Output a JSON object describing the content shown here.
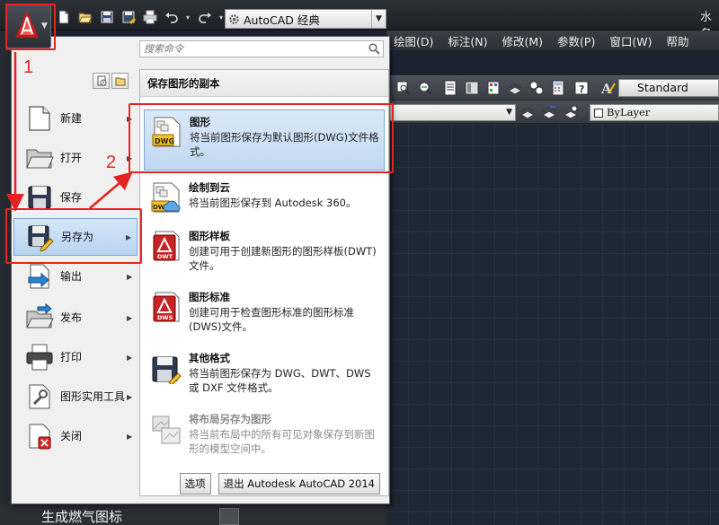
{
  "qat": {
    "workspace": "AutoCAD 经典"
  },
  "window": {
    "title_fragment": "水务"
  },
  "menubar": [
    "绘图(D)",
    "标注(N)",
    "修改(M)",
    "参数(P)",
    "窗口(W)",
    "帮助"
  ],
  "toolbar": {
    "text_style": "Standard",
    "color_control": "ByLayer"
  },
  "app_menu": {
    "search_placeholder": "搜索命令",
    "left_items": [
      {
        "label": "新建",
        "icon": "new-file-icon",
        "submenu": true
      },
      {
        "label": "打开",
        "icon": "open-folder-icon",
        "submenu": true
      },
      {
        "label": "保存",
        "icon": "save-disk-icon",
        "submenu": false
      },
      {
        "label": "另存为",
        "icon": "save-as-icon",
        "submenu": true
      },
      {
        "label": "输出",
        "icon": "export-icon",
        "submenu": true
      },
      {
        "label": "发布",
        "icon": "publish-icon",
        "submenu": true
      },
      {
        "label": "打印",
        "icon": "printer-icon",
        "submenu": true
      },
      {
        "label": "图形实用工具",
        "icon": "drawing-utilities-icon",
        "submenu": true
      },
      {
        "label": "关闭",
        "icon": "close-file-icon",
        "submenu": true
      }
    ],
    "submenu": {
      "header": "保存图形的副本",
      "items": [
        {
          "title": "图形",
          "desc": "将当前图形保存为默认图形(DWG)文件格式。",
          "icon": "dwg-file-icon",
          "badge": "DWG"
        },
        {
          "title": "绘制到云",
          "desc": "将当前图形保存到 Autodesk 360。",
          "icon": "dwg-cloud-icon",
          "badge": "DWG"
        },
        {
          "title": "图形样板",
          "desc": "创建可用于创建新图形的图形样板(DWT)文件。",
          "icon": "dwt-template-icon",
          "badge": "DWT"
        },
        {
          "title": "图形标准",
          "desc": "创建可用于检查图形标准的图形标准(DWS)文件。",
          "icon": "dws-standards-icon",
          "badge": "DWS"
        },
        {
          "title": "其他格式",
          "desc": "将当前图形保存为 DWG、DWT、DWS 或 DXF 文件格式。",
          "icon": "save-other-formats-icon",
          "badge": ""
        },
        {
          "title": "将布局另存为图形",
          "desc": "将当前布局中的所有可见对象保存到新图形的模型空间中。",
          "icon": "save-layout-icon",
          "badge": ""
        }
      ]
    },
    "options_button": "选项",
    "exit_button": "退出 Autodesk AutoCAD 2014"
  },
  "annotations": {
    "step1": "1",
    "step2": "2",
    "color": "#e6231f"
  },
  "status": {
    "layer_name_text": "生成燃气图标"
  }
}
